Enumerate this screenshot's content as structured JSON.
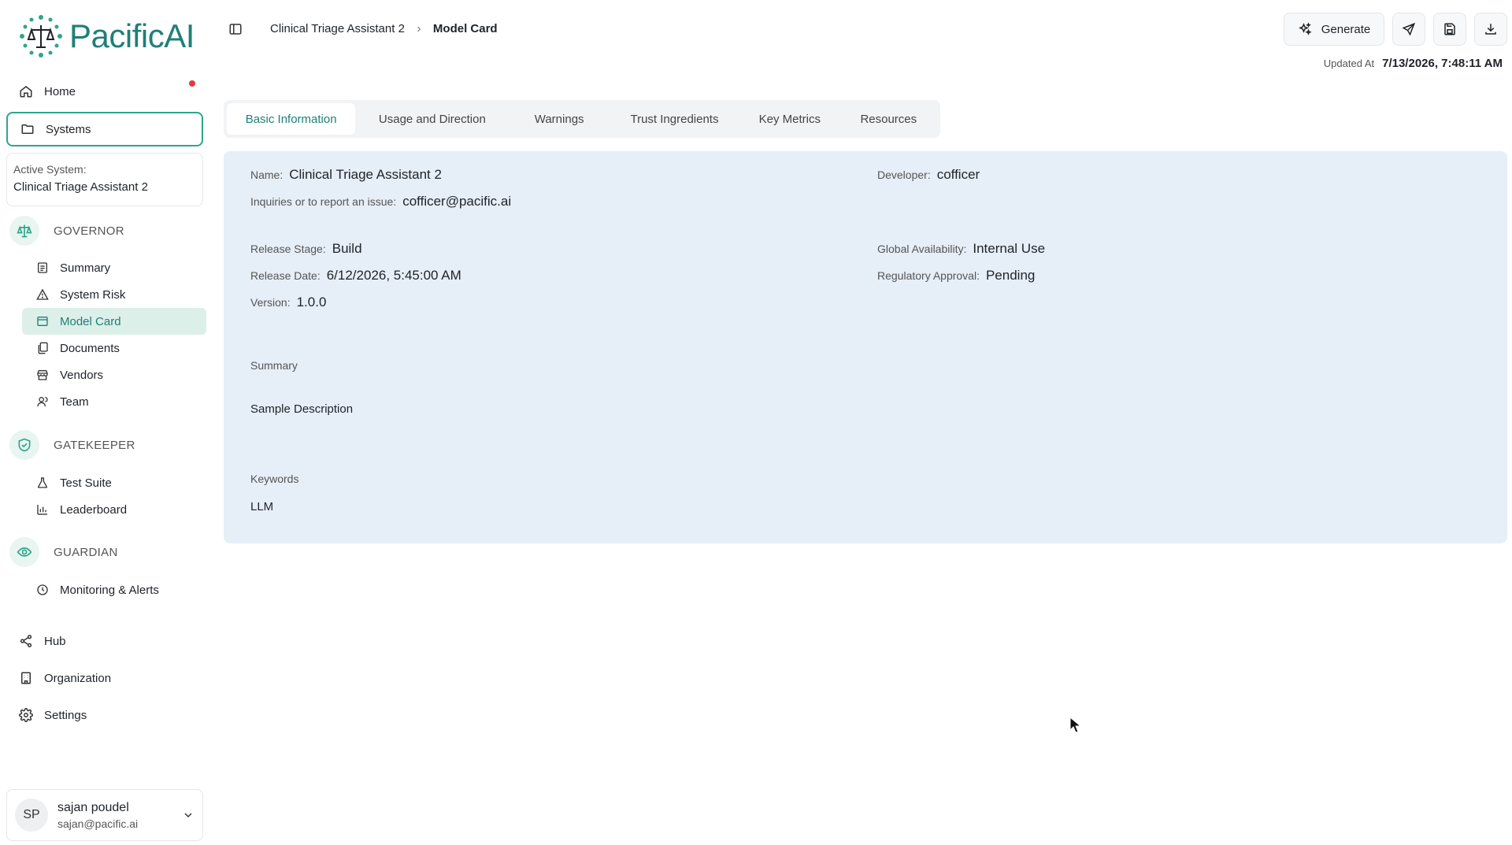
{
  "app": {
    "brand_name": "Pacific",
    "brand_suffix": "AI"
  },
  "sidebar": {
    "home_label": "Home",
    "systems_label": "Systems",
    "active_system_label": "Active System:",
    "active_system_value": "Clinical Triage Assistant 2",
    "governor": {
      "title": "GOVERNOR",
      "items": [
        "Summary",
        "System Risk",
        "Model Card",
        "Documents",
        "Vendors",
        "Team"
      ]
    },
    "gatekeeper": {
      "title": "GATEKEEPER",
      "items": [
        "Test Suite",
        "Leaderboard"
      ]
    },
    "guardian": {
      "title": "GUARDIAN",
      "items": [
        "Monitoring & Alerts"
      ]
    },
    "hub_label": "Hub",
    "organization_label": "Organization",
    "settings_label": "Settings",
    "user": {
      "initials": "SP",
      "name": "sajan poudel",
      "email": "sajan@pacific.ai"
    }
  },
  "header": {
    "breadcrumb": [
      "Clinical Triage Assistant 2",
      "Model Card"
    ],
    "generate_label": "Generate",
    "updated_label": "Updated At",
    "updated_value": "7/13/2026, 7:48:11 AM"
  },
  "tabs": [
    "Basic Information",
    "Usage and Direction",
    "Warnings",
    "Trust Ingredients",
    "Key Metrics",
    "Resources"
  ],
  "basic_info": {
    "name_label": "Name:",
    "name_value": "Clinical Triage Assistant 2",
    "developer_label": "Developer:",
    "developer_value": "cofficer",
    "inquiries_label": "Inquiries or to report an issue:",
    "inquiries_value": "cofficer@pacific.ai",
    "release_stage_label": "Release Stage:",
    "release_stage_value": "Build",
    "global_availability_label": "Global Availability:",
    "global_availability_value": "Internal Use",
    "release_date_label": "Release Date:",
    "release_date_value": "6/12/2026, 5:45:00 AM",
    "regulatory_approval_label": "Regulatory Approval:",
    "regulatory_approval_value": "Pending",
    "version_label": "Version:",
    "version_value": "1.0.0",
    "summary_label": "Summary",
    "summary_value": "Sample Description",
    "keywords_label": "Keywords",
    "keywords_value": "LLM"
  },
  "colors": {
    "accent": "#1f7f78",
    "panel_bg": "#e6eef7",
    "notification_dot": "#e5393d"
  }
}
